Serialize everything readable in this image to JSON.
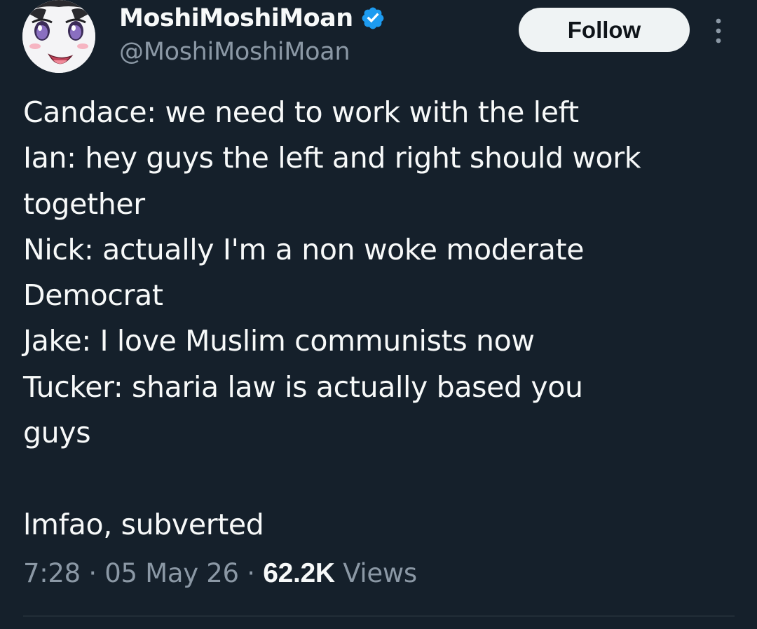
{
  "author": {
    "display_name": "MoshiMoshiMoan",
    "handle": "@MoshiMoshiMoan",
    "verified_color": "#1d9bf0"
  },
  "follow_button": {
    "label": "Follow"
  },
  "more_menu": {
    "icon": "more-vertical-icon"
  },
  "tweet": {
    "lines": [
      "Candace: we need to work with the left",
      "Ian: hey guys the left and right should work",
      "together",
      "Nick: actually I'm a non woke moderate",
      "Democrat",
      "Jake: I love Muslim communists now",
      "Tucker: sharia law is actually based you",
      "guys",
      "",
      "lmfao, subverted"
    ]
  },
  "meta": {
    "time": "7:28",
    "separator": "·",
    "date": "05 May 26",
    "views_count": "62.2K",
    "views_label": "Views"
  },
  "colors": {
    "background": "#15202b",
    "primary_text": "#f7f9f9",
    "secondary_text": "#8b98a5",
    "button_bg": "#eff3f4",
    "divider": "#38444d"
  }
}
